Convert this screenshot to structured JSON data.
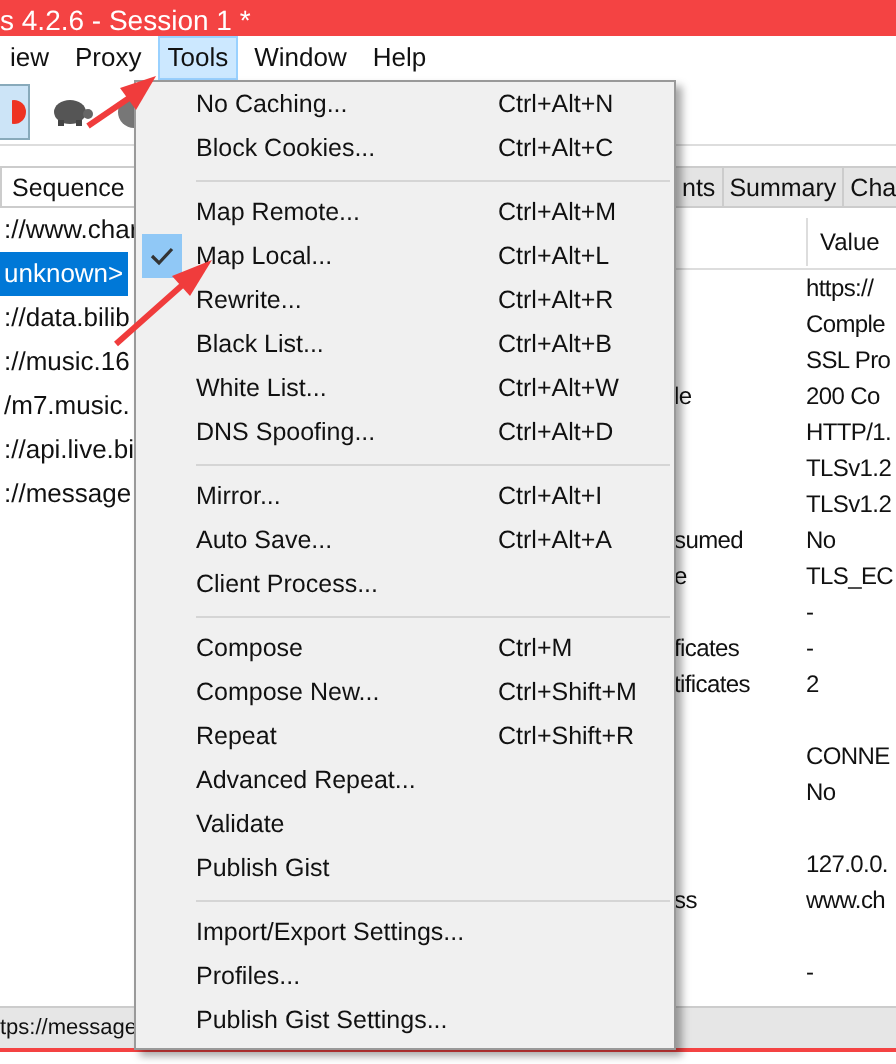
{
  "window": {
    "title": "s 4.2.6 - Session 1 *"
  },
  "menu_bar": [
    {
      "label": "iew",
      "selected": false
    },
    {
      "label": "Proxy",
      "selected": false
    },
    {
      "label": "Tools",
      "selected": true
    },
    {
      "label": "Window",
      "selected": false
    },
    {
      "label": "Help",
      "selected": false
    }
  ],
  "toolbar": {
    "recording": true
  },
  "left_pane": {
    "tabs": [
      {
        "label": "Sequence",
        "selected": true
      }
    ],
    "rows": [
      {
        "text": "://www.char",
        "selected": false
      },
      {
        "text": "unknown>",
        "selected": true
      },
      {
        "text": "://data.bilib",
        "selected": false
      },
      {
        "text": "://music.16",
        "selected": false
      },
      {
        "text": "/m7.music.",
        "selected": false
      },
      {
        "text": "://api.live.bi",
        "selected": false
      },
      {
        "text": "://message",
        "selected": false
      }
    ]
  },
  "right_pane": {
    "tabs": [
      {
        "label": "nts",
        "selected": false
      },
      {
        "label": "Summary",
        "selected": false
      },
      {
        "label": "Cha",
        "selected": false
      }
    ],
    "value_header": "Value",
    "rows": [
      {
        "value": "https://"
      },
      {
        "value": "Comple"
      },
      {
        "value": "SSL Pro"
      },
      {
        "label": "le",
        "value": "200 Co"
      },
      {
        "value": "HTTP/1."
      },
      {
        "value": "TLSv1.2"
      },
      {
        "value": "TLSv1.2"
      },
      {
        "label": "sumed",
        "value": "No"
      },
      {
        "label": "e",
        "value": "TLS_EC"
      },
      {
        "value": "-"
      },
      {
        "label": "ficates",
        "value": "-"
      },
      {
        "label": "tificates",
        "value": "2"
      },
      {},
      {
        "value": "CONNE"
      },
      {
        "value": "No"
      },
      {},
      {
        "value": "127.0.0."
      },
      {
        "label": "ss",
        "value": "www.ch"
      },
      {},
      {
        "value": "-"
      }
    ]
  },
  "status_bar": "tps://message",
  "tools_menu": [
    {
      "kind": "item",
      "label": "No Caching...",
      "shortcut": "Ctrl+Alt+N",
      "checked": false
    },
    {
      "kind": "item",
      "label": "Block Cookies...",
      "shortcut": "Ctrl+Alt+C",
      "checked": false
    },
    {
      "kind": "separator"
    },
    {
      "kind": "item",
      "label": "Map Remote...",
      "shortcut": "Ctrl+Alt+M",
      "checked": false
    },
    {
      "kind": "item",
      "label": "Map Local...",
      "shortcut": "Ctrl+Alt+L",
      "checked": true
    },
    {
      "kind": "item",
      "label": "Rewrite...",
      "shortcut": "Ctrl+Alt+R",
      "checked": false
    },
    {
      "kind": "item",
      "label": "Black List...",
      "shortcut": "Ctrl+Alt+B",
      "checked": false
    },
    {
      "kind": "item",
      "label": "White List...",
      "shortcut": "Ctrl+Alt+W",
      "checked": false
    },
    {
      "kind": "item",
      "label": "DNS Spoofing...",
      "shortcut": "Ctrl+Alt+D",
      "checked": false
    },
    {
      "kind": "separator"
    },
    {
      "kind": "item",
      "label": "Mirror...",
      "shortcut": "Ctrl+Alt+I",
      "checked": false
    },
    {
      "kind": "item",
      "label": "Auto Save...",
      "shortcut": "Ctrl+Alt+A",
      "checked": false
    },
    {
      "kind": "item",
      "label": "Client Process...",
      "checked": false
    },
    {
      "kind": "separator"
    },
    {
      "kind": "item",
      "label": "Compose",
      "shortcut": "Ctrl+M",
      "checked": false
    },
    {
      "kind": "item",
      "label": "Compose New...",
      "shortcut": "Ctrl+Shift+M",
      "checked": false
    },
    {
      "kind": "item",
      "label": "Repeat",
      "shortcut": "Ctrl+Shift+R",
      "checked": false
    },
    {
      "kind": "item",
      "label": "Advanced Repeat...",
      "checked": false
    },
    {
      "kind": "item",
      "label": "Validate",
      "checked": false
    },
    {
      "kind": "item",
      "label": "Publish Gist",
      "checked": false
    },
    {
      "kind": "separator"
    },
    {
      "kind": "item",
      "label": "Import/Export Settings...",
      "checked": false
    },
    {
      "kind": "item",
      "label": "Profiles...",
      "checked": false
    },
    {
      "kind": "item",
      "label": "Publish Gist Settings...",
      "checked": false
    }
  ]
}
